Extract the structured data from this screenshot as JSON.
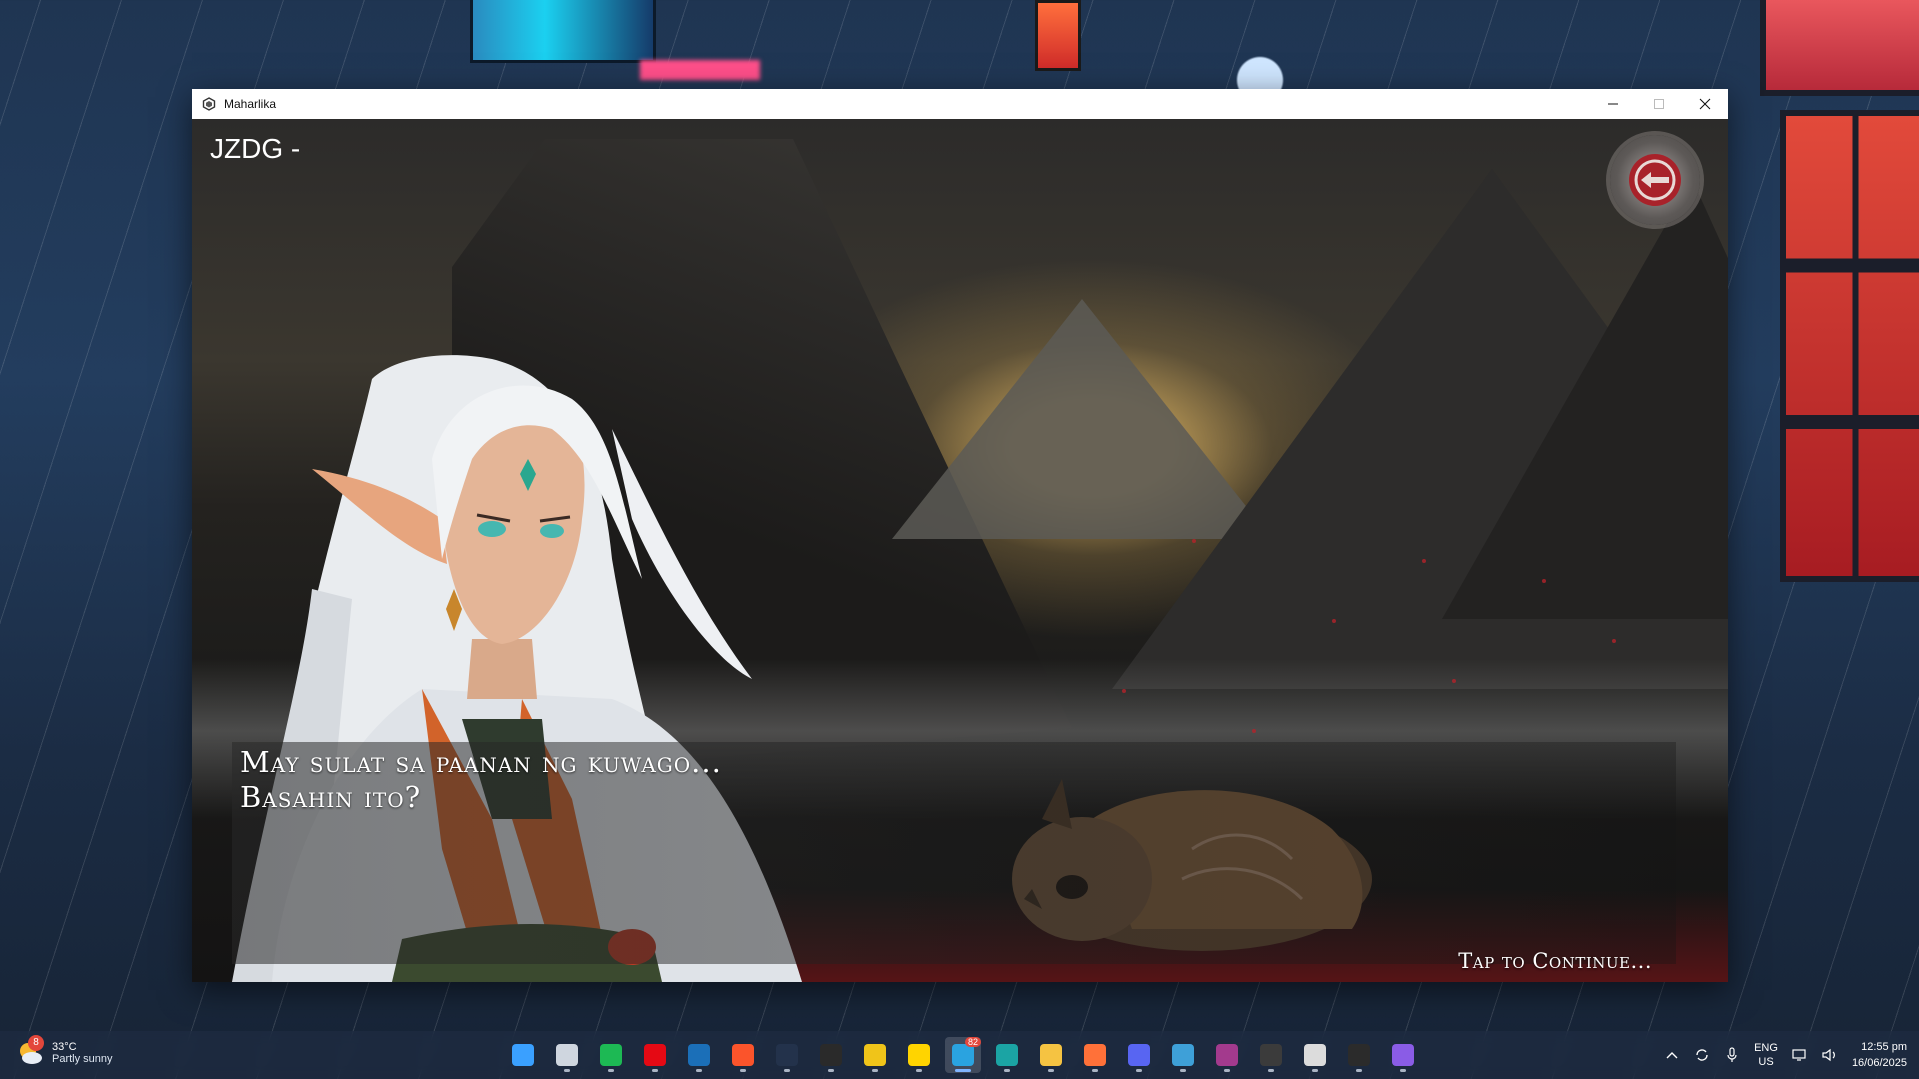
{
  "window": {
    "title": "Maharlika"
  },
  "game": {
    "title": "JZDG -",
    "dialogue": "May sulat sa paanan ng kuwago...\nBasahin ito?",
    "continue_prompt": "Tap to Continue..."
  },
  "taskbar": {
    "weather": {
      "badge": "8",
      "temperature": "33°C",
      "condition": "Partly sunny"
    },
    "apps": [
      {
        "name": "start",
        "color": "#3aa0ff"
      },
      {
        "name": "task-view",
        "color": "#cfd6df"
      },
      {
        "name": "spotify",
        "color": "#1db954"
      },
      {
        "name": "netflix",
        "color": "#e50914"
      },
      {
        "name": "steam",
        "color": "#1b6fb8"
      },
      {
        "name": "brave",
        "color": "#fb542b"
      },
      {
        "name": "app-dark",
        "color": "#23324b"
      },
      {
        "name": "epic-games",
        "color": "#2a2a2a"
      },
      {
        "name": "sticky-app",
        "color": "#f0c419"
      },
      {
        "name": "sticky-notes",
        "color": "#ffd400"
      },
      {
        "name": "telegram",
        "color": "#2aa3e0",
        "active": true,
        "badge": "82"
      },
      {
        "name": "edge",
        "color": "#1ba4a4"
      },
      {
        "name": "file-explorer",
        "color": "#f5c342"
      },
      {
        "name": "firefox",
        "color": "#ff7139"
      },
      {
        "name": "discord",
        "color": "#5865f2"
      },
      {
        "name": "browser-globe",
        "color": "#3ea0d8"
      },
      {
        "name": "winrar",
        "color": "#a33a8d"
      },
      {
        "name": "obs",
        "color": "#3b3b3b"
      },
      {
        "name": "unity",
        "color": "#dcdcdc"
      },
      {
        "name": "media-player",
        "color": "#2b2b2b"
      },
      {
        "name": "folder-purple",
        "color": "#8a5ce6"
      }
    ],
    "tray": {
      "lang_line1": "ENG",
      "lang_line2": "US",
      "time": "12:55 pm",
      "date": "16/06/2025"
    }
  }
}
